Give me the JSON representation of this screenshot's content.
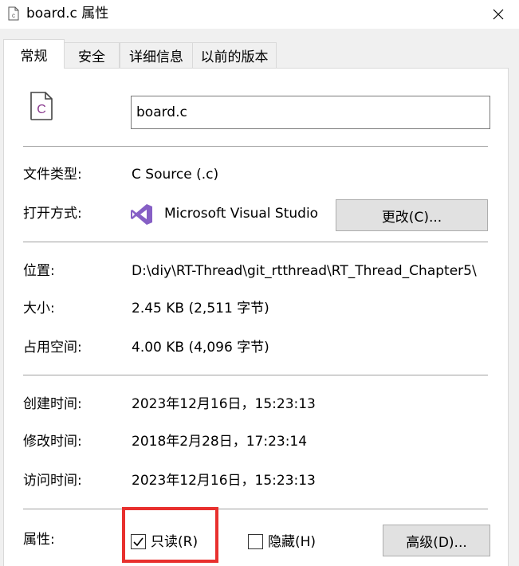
{
  "window": {
    "title": "board.c 属性",
    "title_icon": "c-file-icon",
    "close_icon": "close-icon"
  },
  "tabs": [
    {
      "label": "常规",
      "active": true
    },
    {
      "label": "安全",
      "active": false
    },
    {
      "label": "详细信息",
      "active": false
    },
    {
      "label": "以前的版本",
      "active": false
    }
  ],
  "general": {
    "file_icon": "c-source-file-icon",
    "file_name": "board.c",
    "type_label": "文件类型:",
    "type_value": "C Source (.c)",
    "opens_with_label": "打开方式:",
    "opens_with_icon": "visual-studio-icon",
    "opens_with_value": "Microsoft Visual Studio",
    "change_button": "更改(C)...",
    "location_label": "位置:",
    "location_value": "D:\\diy\\RT-Thread\\git_rtthread\\RT_Thread_Chapter5\\",
    "size_label": "大小:",
    "size_value": "2.45 KB (2,511 字节)",
    "size_on_disk_label": "占用空间:",
    "size_on_disk_value": "4.00 KB (4,096 字节)",
    "created_label": "创建时间:",
    "created_value": "2023年12月16日，15:23:13",
    "modified_label": "修改时间:",
    "modified_value": "2018年2月28日，17:23:14",
    "accessed_label": "访问时间:",
    "accessed_value": "2023年12月16日，15:23:13",
    "attributes_label": "属性:",
    "readonly_label": "只读(R)",
    "readonly_checked": true,
    "hidden_label": "隐藏(H)",
    "hidden_checked": false,
    "advanced_button": "高级(D)..."
  },
  "colors": {
    "highlight": "#e8302e",
    "vs_purple": "#865fc5",
    "c_icon": "#8a3b8f"
  }
}
